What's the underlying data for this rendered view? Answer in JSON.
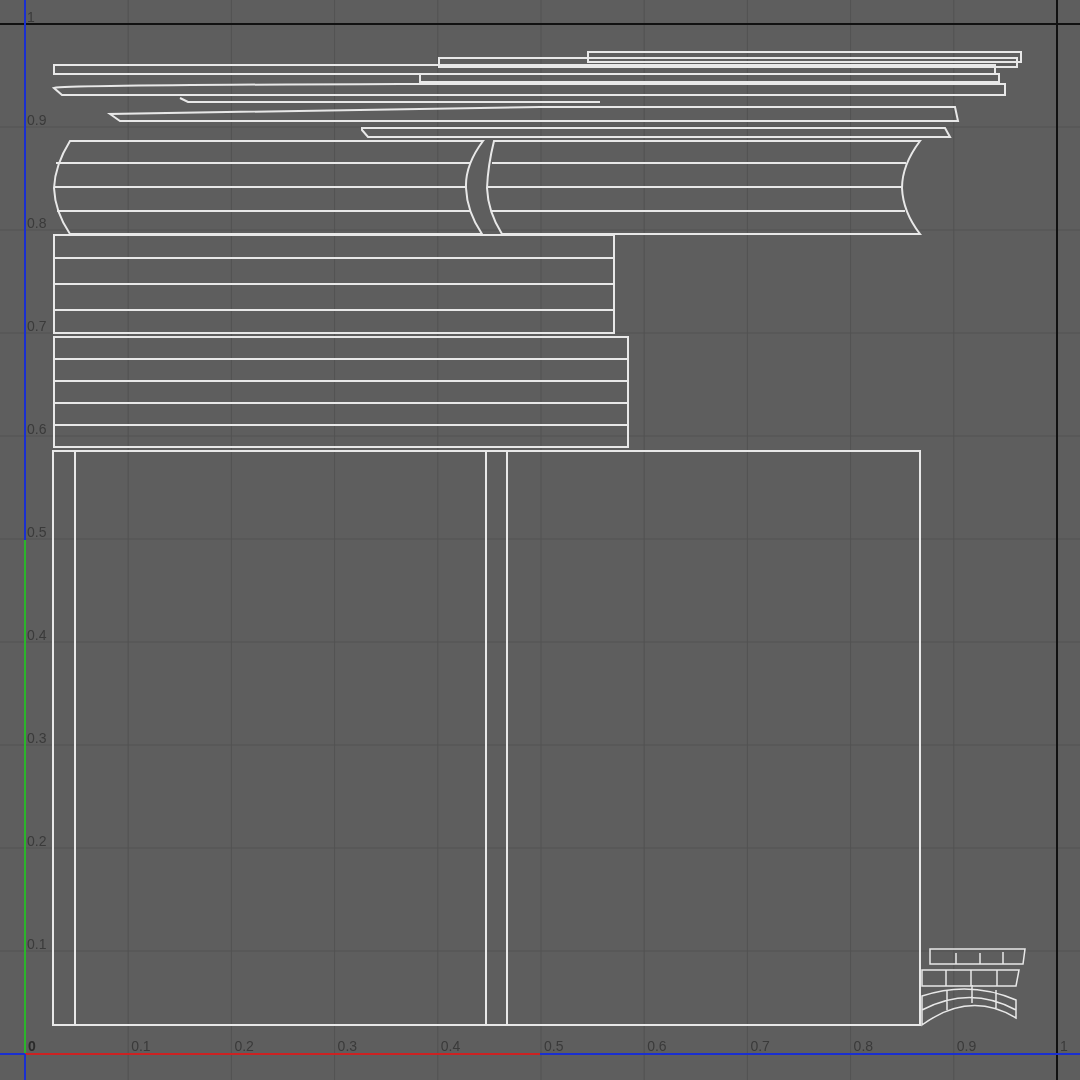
{
  "u_axis": {
    "labels": [
      "0",
      "0.1",
      "0.2",
      "0.3",
      "0.4",
      "0.5",
      "0.6",
      "0.7",
      "0.8",
      "0.9",
      "1"
    ]
  },
  "v_axis": {
    "labels": [
      "1",
      "0.9",
      "0.8",
      "0.7",
      "0.6",
      "0.5",
      "0.4",
      "0.3",
      "0.2",
      "0.1"
    ]
  }
}
